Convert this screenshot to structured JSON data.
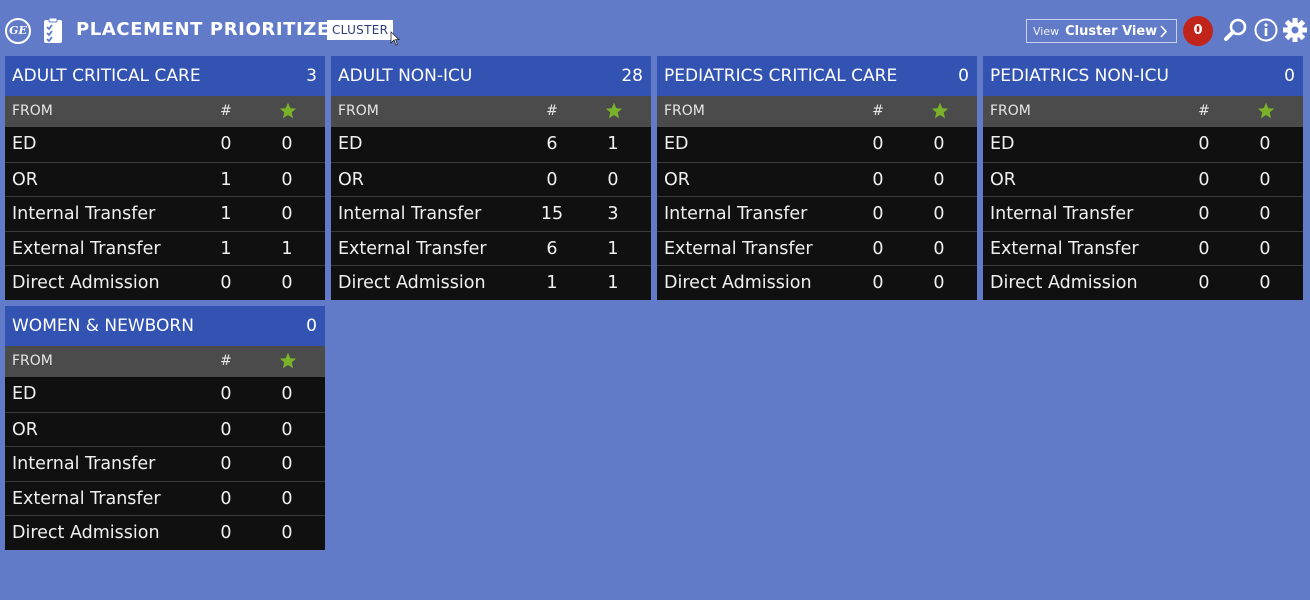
{
  "header": {
    "logo_text": "GE",
    "title": "PLACEMENT PRIORITIZER",
    "badge": "CLUSTER",
    "view_label": "View",
    "view_value": "Cluster View",
    "alert_count": "0"
  },
  "colors": {
    "background": "#617bc8",
    "panel_header": "#3353b3",
    "column_header": "#4b4b4b",
    "row_background": "#101010",
    "star": "#7ab32a",
    "alert": "#c0241a"
  },
  "icons": [
    "ge-logo",
    "clipboard-icon",
    "chevron-right-icon",
    "search-icon",
    "info-icon",
    "gear-icon",
    "star-icon"
  ],
  "columns": {
    "from": "FROM",
    "count": "#"
  },
  "panels": [
    {
      "name": "ADULT CRITICAL CARE",
      "total": "3",
      "rows": [
        {
          "from": "ED",
          "count": "0",
          "starred": "0"
        },
        {
          "from": "OR",
          "count": "1",
          "starred": "0"
        },
        {
          "from": "Internal Transfer",
          "count": "1",
          "starred": "0"
        },
        {
          "from": "External Transfer",
          "count": "1",
          "starred": "1"
        },
        {
          "from": "Direct Admission",
          "count": "0",
          "starred": "0"
        }
      ]
    },
    {
      "name": "ADULT NON-ICU",
      "total": "28",
      "rows": [
        {
          "from": "ED",
          "count": "6",
          "starred": "1"
        },
        {
          "from": "OR",
          "count": "0",
          "starred": "0"
        },
        {
          "from": "Internal Transfer",
          "count": "15",
          "starred": "3"
        },
        {
          "from": "External Transfer",
          "count": "6",
          "starred": "1"
        },
        {
          "from": "Direct Admission",
          "count": "1",
          "starred": "1"
        }
      ]
    },
    {
      "name": "PEDIATRICS CRITICAL CARE",
      "total": "0",
      "rows": [
        {
          "from": "ED",
          "count": "0",
          "starred": "0"
        },
        {
          "from": "OR",
          "count": "0",
          "starred": "0"
        },
        {
          "from": "Internal Transfer",
          "count": "0",
          "starred": "0"
        },
        {
          "from": "External Transfer",
          "count": "0",
          "starred": "0"
        },
        {
          "from": "Direct Admission",
          "count": "0",
          "starred": "0"
        }
      ]
    },
    {
      "name": "PEDIATRICS NON-ICU",
      "total": "0",
      "rows": [
        {
          "from": "ED",
          "count": "0",
          "starred": "0"
        },
        {
          "from": "OR",
          "count": "0",
          "starred": "0"
        },
        {
          "from": "Internal Transfer",
          "count": "0",
          "starred": "0"
        },
        {
          "from": "External Transfer",
          "count": "0",
          "starred": "0"
        },
        {
          "from": "Direct Admission",
          "count": "0",
          "starred": "0"
        }
      ]
    },
    {
      "name": "WOMEN & NEWBORN",
      "total": "0",
      "rows": [
        {
          "from": "ED",
          "count": "0",
          "starred": "0"
        },
        {
          "from": "OR",
          "count": "0",
          "starred": "0"
        },
        {
          "from": "Internal Transfer",
          "count": "0",
          "starred": "0"
        },
        {
          "from": "External Transfer",
          "count": "0",
          "starred": "0"
        },
        {
          "from": "Direct Admission",
          "count": "0",
          "starred": "0"
        }
      ]
    }
  ]
}
